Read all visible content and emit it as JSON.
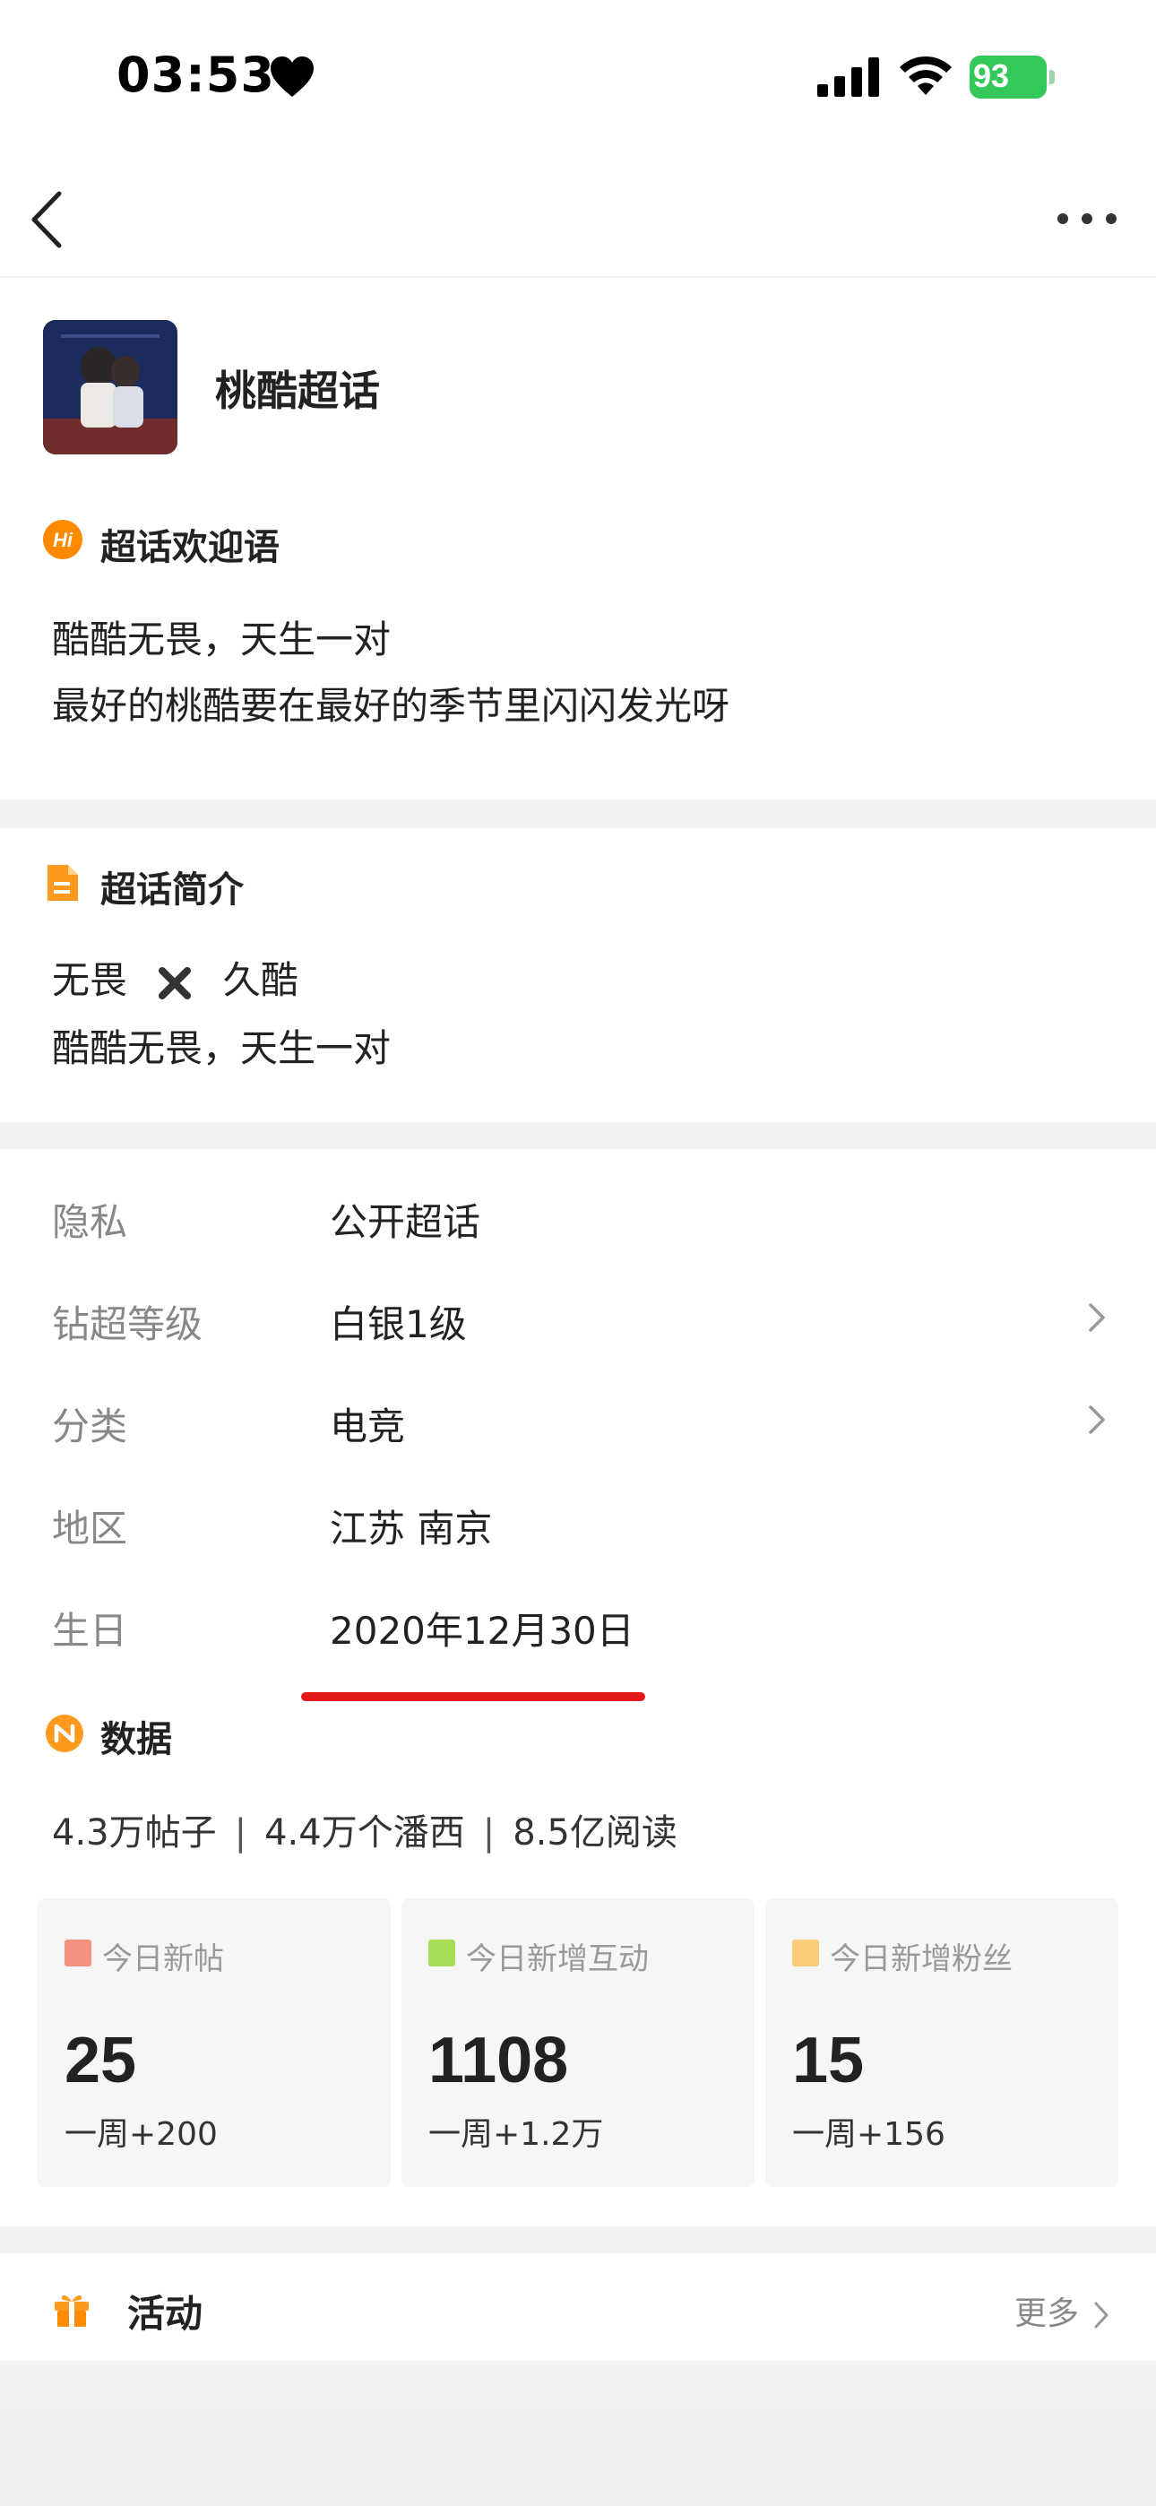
{
  "status_bar": {
    "time": "03:53",
    "battery": "93"
  },
  "topic": {
    "name": "桃酷超话"
  },
  "welcome": {
    "title": "超话欢迎语",
    "icon_text": "Hi",
    "lines": [
      "酷酷无畏，天生一对",
      "最好的桃酷要在最好的季节里闪闪发光呀"
    ]
  },
  "intro": {
    "title": "超话简介",
    "line1_left": "无畏",
    "line1_right": "久酷",
    "line2": "酷酷无畏，天生一对"
  },
  "info": {
    "privacy_label": "隐私",
    "privacy_value": "公开超话",
    "level_label": "钻超等级",
    "level_value": "白银1级",
    "category_label": "分类",
    "category_value": "电竞",
    "region_label": "地区",
    "region_value": "江苏 南京",
    "birthday_label": "生日",
    "birthday_value": "2020年12月30日"
  },
  "data": {
    "title": "数据",
    "posts": "4.3万帖子",
    "fans": "4.4万个潘西",
    "reads": "8.5亿阅读",
    "cards": [
      {
        "label": "今日新帖",
        "value": "25",
        "week": "一周+200",
        "color": "#f6907f"
      },
      {
        "label": "今日新增互动",
        "value": "1108",
        "week": "一周+1.2万",
        "color": "#a6dd57"
      },
      {
        "label": "今日新增粉丝",
        "value": "15",
        "week": "一周+156",
        "color": "#f8cd76"
      }
    ]
  },
  "activity": {
    "title": "活动",
    "more": "更多"
  },
  "colors": {
    "accent_orange": "#ff8a00",
    "annotation_red": "#e21a1a",
    "battery_green": "#34c759"
  }
}
